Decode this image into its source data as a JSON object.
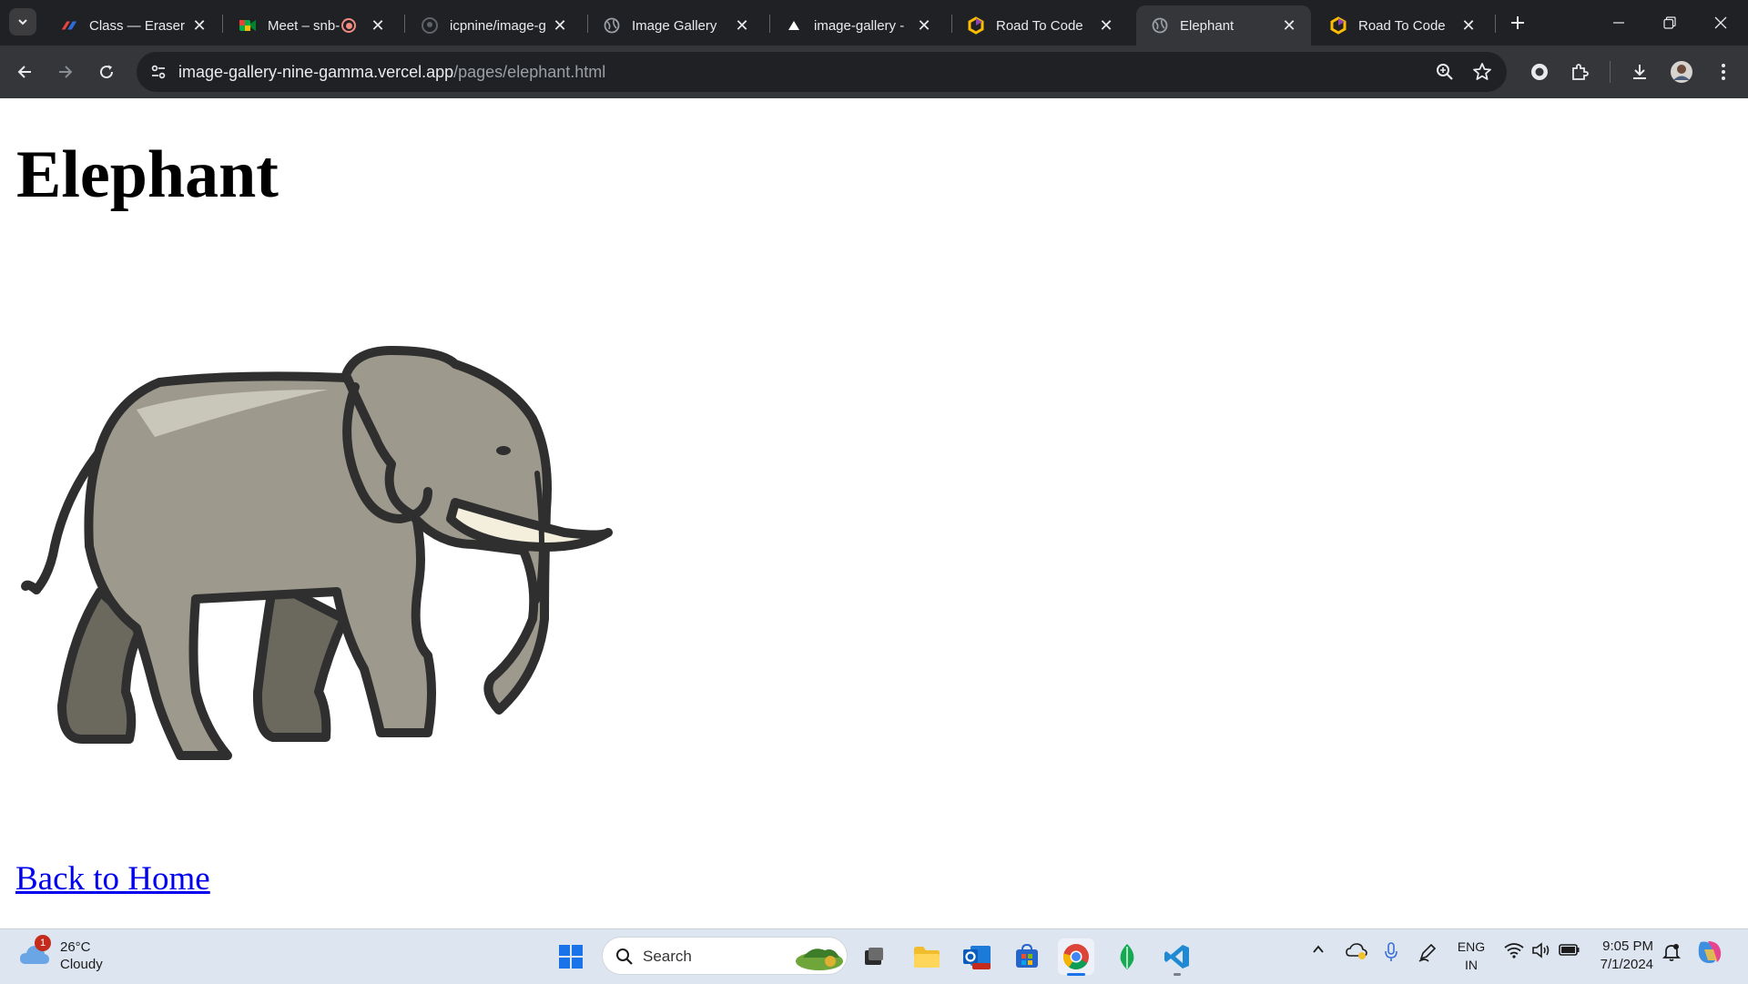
{
  "browser": {
    "tabs": [
      {
        "title": "Class — Eraser",
        "icon": "eraser-icon",
        "active": false
      },
      {
        "title": "Meet – snb-",
        "icon": "google-meet-icon",
        "active": false
      },
      {
        "title": "icpnine/image-g",
        "icon": "github-icon",
        "active": false
      },
      {
        "title": "Image Gallery",
        "icon": "globe-icon",
        "active": false
      },
      {
        "title": "image-gallery - ",
        "icon": "vercel-icon",
        "active": false
      },
      {
        "title": "Road To Code",
        "icon": "roadtocode-icon",
        "active": false
      },
      {
        "title": "Elephant",
        "icon": "globe-icon",
        "active": true
      },
      {
        "title": "Road To Code",
        "icon": "roadtocode-icon",
        "active": false
      }
    ],
    "address": {
      "host": "image-gallery-nine-gamma.vercel.app",
      "path": "/pages/elephant.html"
    }
  },
  "page": {
    "heading": "Elephant",
    "image": {
      "icon": "elephant-illustration"
    },
    "back_link": "Back to Home"
  },
  "taskbar": {
    "weather": {
      "temp": "26°C",
      "condition": "Cloudy",
      "badge": "1"
    },
    "search_placeholder": "Search",
    "language": {
      "line1": "ENG",
      "line2": "IN"
    },
    "clock": {
      "time": "9:05 PM",
      "date": "7/1/2024"
    }
  },
  "colors": {
    "tabstrip": "#202124",
    "toolbar": "#35363a",
    "link": "#0000ee",
    "taskbar": "#dde5f0",
    "elephant_body": "#9d9a8d",
    "elephant_shadow": "#6b685e",
    "elephant_outline": "#2f2f2f",
    "tusk": "#f3efdc"
  }
}
